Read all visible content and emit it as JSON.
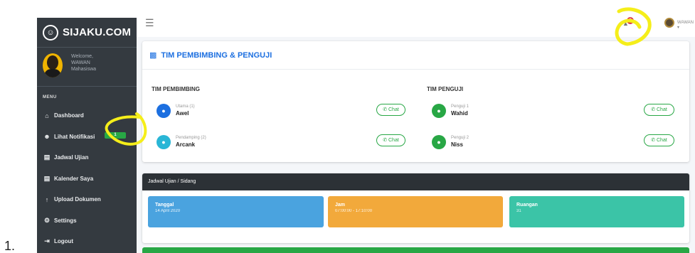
{
  "list_number": "1.",
  "brand": {
    "name": "SIJAKU.COM"
  },
  "user_panel": {
    "line1": "Welcome,",
    "line2": "WAWAN",
    "line3": "Mahasiswa"
  },
  "sidebar": {
    "menu_header": "MENU",
    "items": [
      {
        "label": "Dashboard",
        "icon": "home-icon",
        "glyph": "⌂"
      },
      {
        "label": "Lihat Notifikasi",
        "icon": "users-icon",
        "glyph": "☻",
        "badge": "1"
      },
      {
        "label": "Jadwal Ujian",
        "icon": "calendar-icon",
        "glyph": "▤"
      },
      {
        "label": "Kalender Saya",
        "icon": "calendar-icon",
        "glyph": "▤"
      },
      {
        "label": "Upload Dokumen",
        "icon": "upload-icon",
        "glyph": "↑"
      },
      {
        "label": "Settings",
        "icon": "gear-icon",
        "glyph": "⚙"
      },
      {
        "label": "Logout",
        "icon": "logout-icon",
        "glyph": "⇥"
      }
    ]
  },
  "topbar": {
    "notif_count": "2",
    "user_name": "WAWAN"
  },
  "tim": {
    "title": "TIM PEMBIMBING & PENGUJI",
    "pembimbing_title": "TIM PEMBIMBING",
    "penguji_title": "TIM PENGUJI",
    "pembimbing": [
      {
        "role": "Utama (1)",
        "name": "Awel",
        "chat": "Chat"
      },
      {
        "role": "Pendamping (2)",
        "name": "Arcank",
        "chat": "Chat"
      }
    ],
    "penguji": [
      {
        "role": "Penguji 1",
        "name": "Wahid",
        "chat": "Chat"
      },
      {
        "role": "Penguji 2",
        "name": "Niss",
        "chat": "Chat"
      }
    ]
  },
  "jadwal": {
    "header": "Jadwal Ujian / Sidang",
    "boxes": [
      {
        "label": "Tanggal",
        "value": "14 April 2020"
      },
      {
        "label": "Jam",
        "value": "07:00:00 - 17:10:00"
      },
      {
        "label": "Ruangan",
        "value": "31"
      }
    ]
  },
  "colors": {
    "sidebar": "#343a40",
    "accent_blue": "#1c6fe0",
    "success": "#28a745",
    "info_blue": "#4aa3df",
    "warning": "#f2a93b",
    "teal": "#3bc4a7",
    "annotation": "#f5ee1a"
  }
}
